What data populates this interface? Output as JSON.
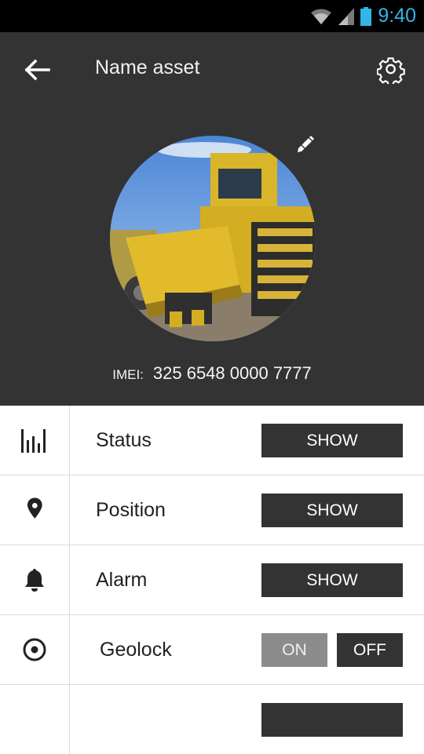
{
  "status_bar": {
    "time": "9:40",
    "icons": [
      "wifi-icon",
      "signal-icon",
      "battery-icon"
    ]
  },
  "header": {
    "title": "Name asset",
    "back_icon": "arrow-left-icon",
    "settings_icon": "gear-icon",
    "edit_icon": "pencil-icon"
  },
  "asset": {
    "imei_label": "IMEI:",
    "imei_value": "325 6548 0000 7777",
    "photo": "bulldozer-photo"
  },
  "list": {
    "rows": [
      {
        "label": "Status",
        "icon": "bar-chart-icon",
        "button": "SHOW"
      },
      {
        "label": "Position",
        "icon": "map-pin-icon",
        "button": "SHOW"
      },
      {
        "label": "Alarm",
        "icon": "bell-icon",
        "button": "SHOW"
      },
      {
        "label": "Geolock",
        "icon": "target-icon",
        "toggle_on": "ON",
        "toggle_off": "OFF"
      }
    ]
  },
  "colors": {
    "header_bg": "#333333",
    "status_clock": "#33b5e5",
    "button_dark": "#333333",
    "toggle_inactive": "#8c8c8c"
  }
}
